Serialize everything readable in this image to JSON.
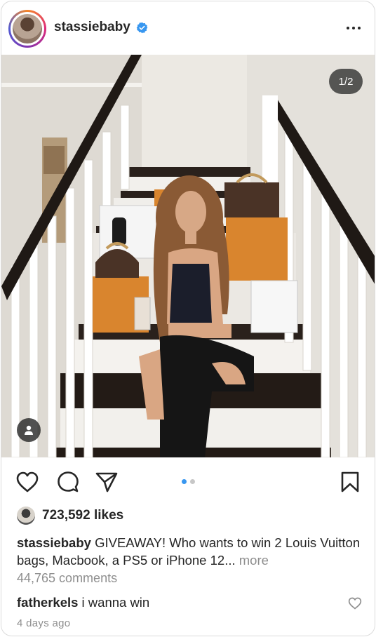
{
  "post": {
    "username": "stassiebaby",
    "verified": true,
    "avatar_icon": "profile-avatar",
    "more_icon": "more-horizontal-icon",
    "image_counter": "1/2",
    "tag_icon": "user-tag-icon",
    "carousel": {
      "current": 1,
      "total": 2
    }
  },
  "actions": {
    "like_icon": "heart-icon",
    "comment_icon": "comment-icon",
    "share_icon": "send-icon",
    "save_icon": "bookmark-icon"
  },
  "likes": {
    "count_text": "723,592 likes"
  },
  "caption": {
    "username": "stassiebaby",
    "text": "GIVEAWAY! Who wants to win 2 Louis Vuitton bags, Macbook, a PS5 or iPhone 12...",
    "more": "more"
  },
  "comments_link": "44,765 comments",
  "comment": {
    "username": "fatherkels",
    "text": "i wanna win",
    "like_icon": "heart-outline-icon"
  },
  "timestamp": "4 days ago",
  "colors": {
    "accent": "#3897f0",
    "text": "#262626",
    "muted": "#8e8e8e",
    "verified": "#3897f0"
  }
}
